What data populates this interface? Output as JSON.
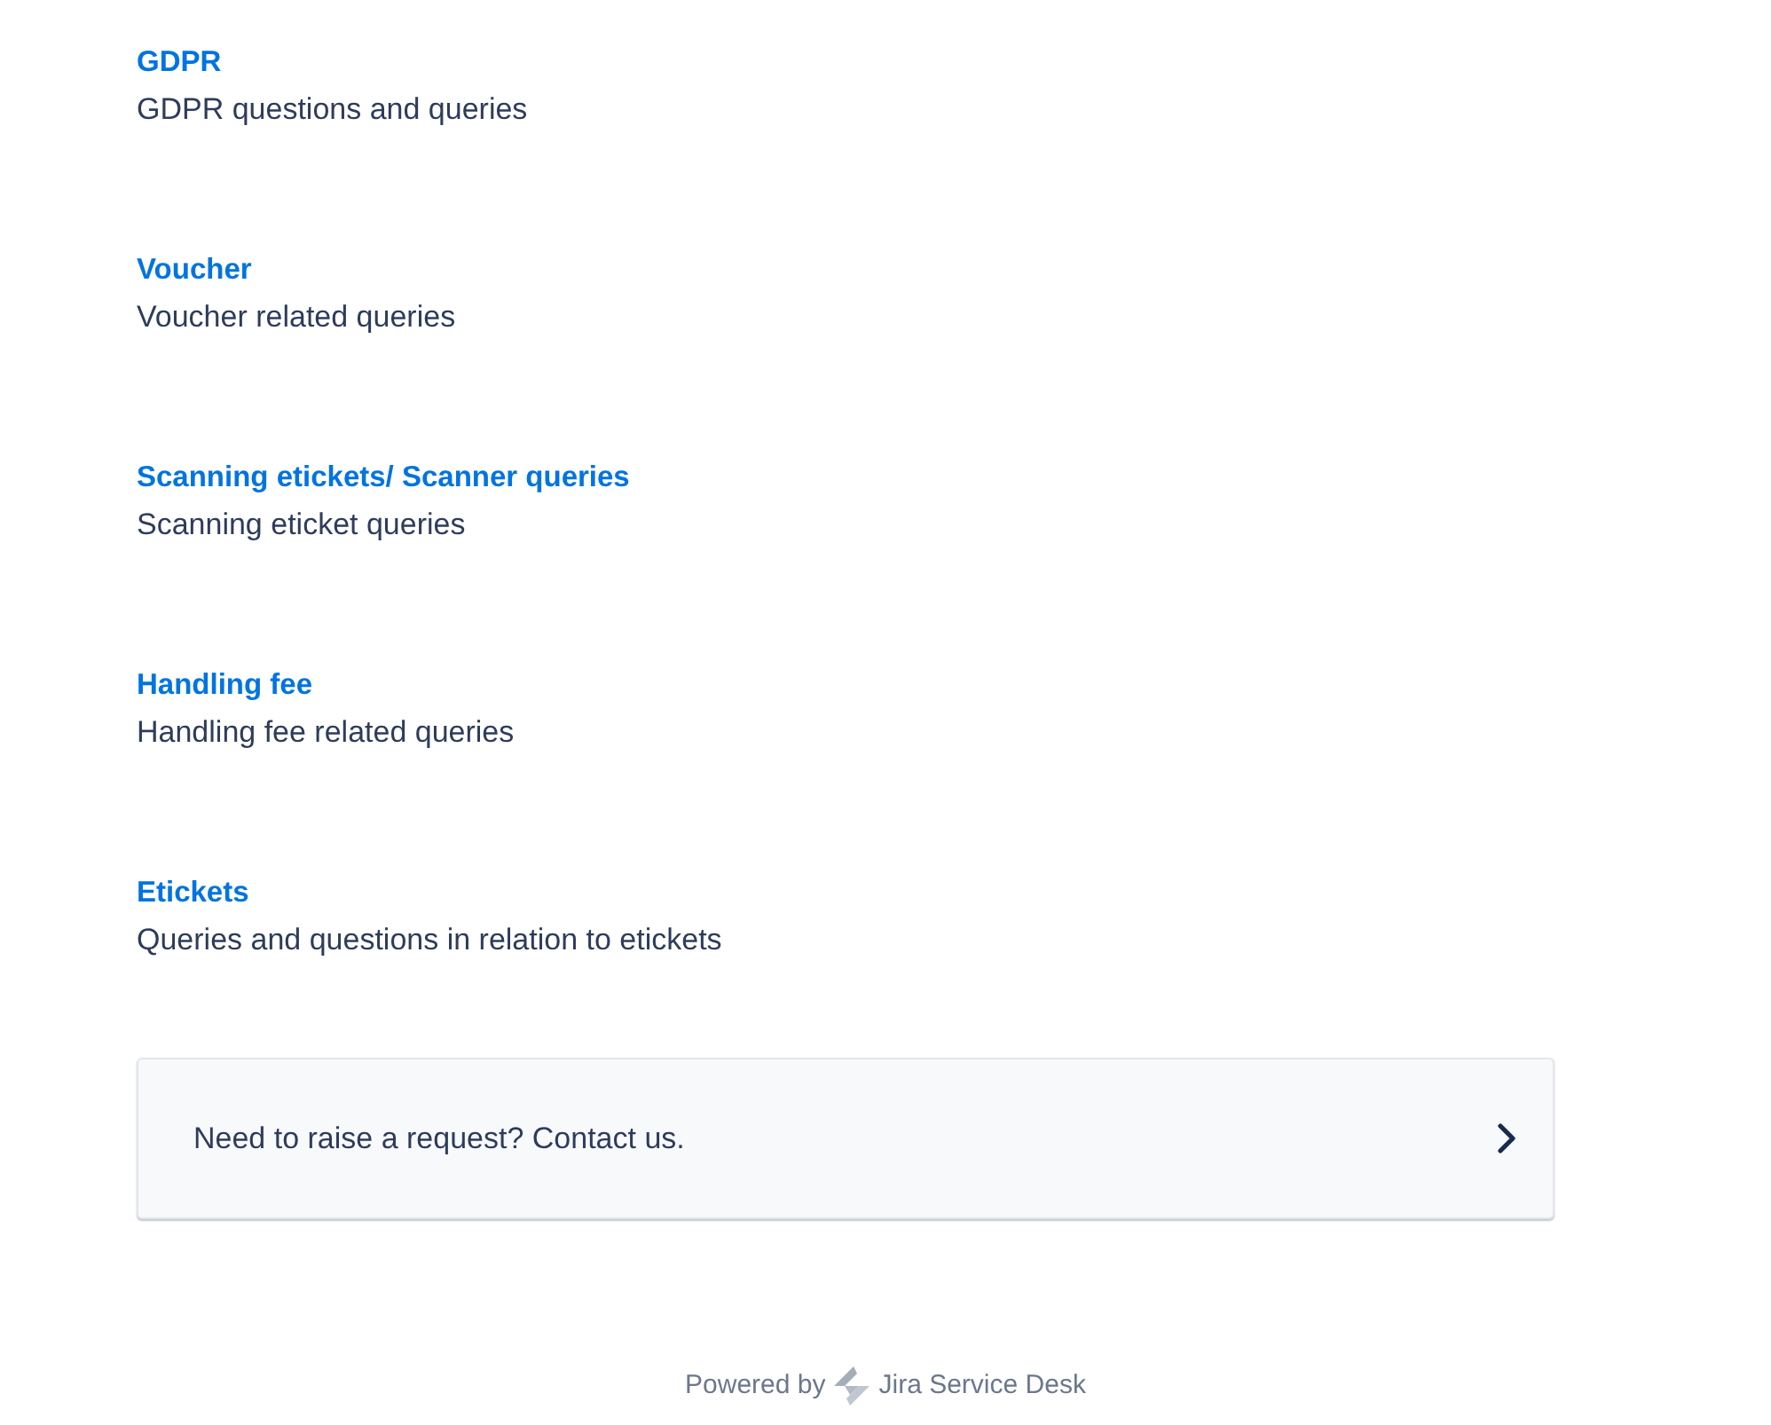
{
  "categories": [
    {
      "title": "GDPR",
      "description": "GDPR questions and queries"
    },
    {
      "title": "Voucher",
      "description": "Voucher related queries"
    },
    {
      "title": "Scanning etickets/ Scanner queries",
      "description": "Scanning eticket queries"
    },
    {
      "title": "Handling fee",
      "description": "Handling fee related queries"
    },
    {
      "title": "Etickets",
      "description": "Queries and questions in relation to etickets"
    }
  ],
  "contact_card": {
    "text": "Need to raise a request? Contact us."
  },
  "footer": {
    "prefix": "Powered by",
    "product": "Jira Service Desk"
  }
}
